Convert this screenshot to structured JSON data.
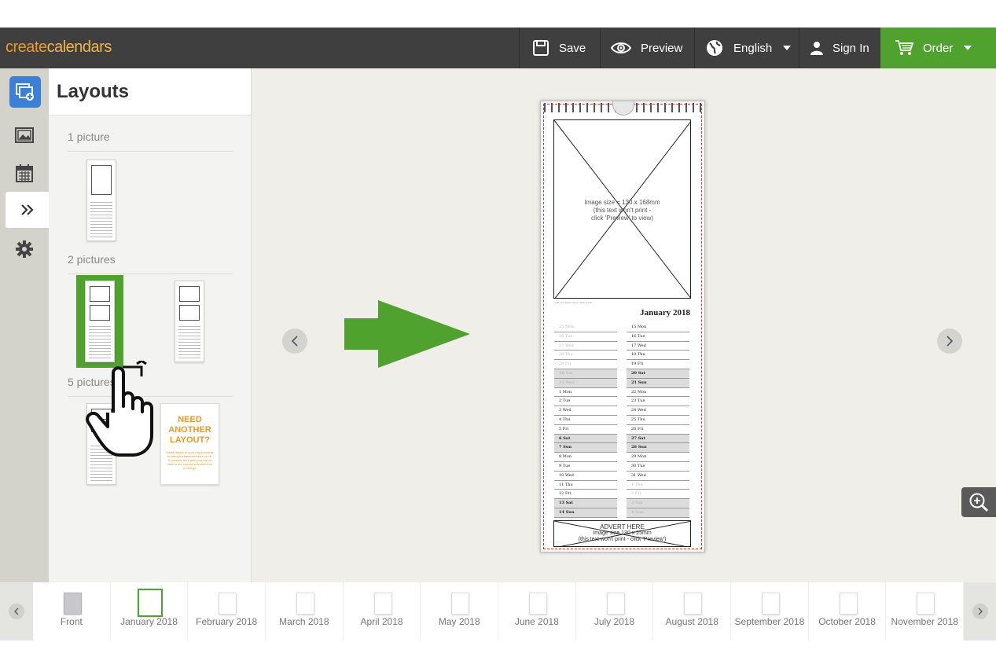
{
  "header": {
    "logo_part1": "create",
    "logo_part2": "calendars",
    "save": "Save",
    "preview": "Preview",
    "language": "English",
    "sign_in": "Sign In",
    "order": "Order",
    "order_color": "#4fa22e"
  },
  "rail": {
    "icons": [
      "add-photos-icon",
      "photos-icon",
      "calendar-icon",
      "layouts-icon",
      "settings-icon"
    ]
  },
  "panel": {
    "title": "Layouts",
    "sections": [
      "1 picture",
      "2 pictures",
      "5 pictures"
    ],
    "need_title": "NEED ANOTHER LAYOUT?",
    "need_body": "Email details of your requirements to sales@createcalendars.co.uk. If possible we'll add your layout idea to our current selection free of charge."
  },
  "calendar": {
    "image_text_1": "Image size = 130 x 168mm",
    "image_text_2": "(this text won't print -",
    "image_text_3": "click 'Preview' to view)",
    "caption": "Add your caption here - click to edit",
    "month_title": "January 2018",
    "left_days": [
      {
        "t": "25 Mon",
        "s": "fade"
      },
      {
        "t": "26 Tue",
        "s": "fade"
      },
      {
        "t": "27 Wed",
        "s": "fade"
      },
      {
        "t": "28 Thu",
        "s": "fade"
      },
      {
        "t": "29 Fri",
        "s": "fade"
      },
      {
        "t": "30 Sat",
        "s": "fade we"
      },
      {
        "t": "31 Sun",
        "s": "fade we"
      },
      {
        "t": "1 Mon",
        "s": ""
      },
      {
        "t": "2 Tue",
        "s": ""
      },
      {
        "t": "3 Wed",
        "s": ""
      },
      {
        "t": "4 Thu",
        "s": ""
      },
      {
        "t": "5 Fri",
        "s": ""
      },
      {
        "t": "6 Sat",
        "s": "we"
      },
      {
        "t": "7 Sun",
        "s": "we"
      },
      {
        "t": "8 Mon",
        "s": ""
      },
      {
        "t": "9 Tue",
        "s": ""
      },
      {
        "t": "10 Wed",
        "s": ""
      },
      {
        "t": "11 Thu",
        "s": ""
      },
      {
        "t": "12 Fri",
        "s": ""
      },
      {
        "t": "13 Sat",
        "s": "we"
      },
      {
        "t": "14 Sun",
        "s": "we"
      }
    ],
    "right_days": [
      {
        "t": "15 Mon",
        "s": ""
      },
      {
        "t": "16 Tue",
        "s": ""
      },
      {
        "t": "17 Wed",
        "s": ""
      },
      {
        "t": "18 Thu",
        "s": ""
      },
      {
        "t": "19 Fri",
        "s": ""
      },
      {
        "t": "20 Sat",
        "s": "we"
      },
      {
        "t": "21 Sun",
        "s": "we"
      },
      {
        "t": "22 Mon",
        "s": ""
      },
      {
        "t": "23 Tue",
        "s": ""
      },
      {
        "t": "24 Wed",
        "s": ""
      },
      {
        "t": "25 Thu",
        "s": ""
      },
      {
        "t": "26 Fri",
        "s": ""
      },
      {
        "t": "27 Sat",
        "s": "we"
      },
      {
        "t": "28 Sun",
        "s": "we"
      },
      {
        "t": "29 Mon",
        "s": ""
      },
      {
        "t": "30 Tue",
        "s": ""
      },
      {
        "t": "31 Wed",
        "s": ""
      },
      {
        "t": "1 Thu",
        "s": "fade"
      },
      {
        "t": "2 Fri",
        "s": "fade"
      },
      {
        "t": "3 Sat",
        "s": "fade we"
      },
      {
        "t": "4 Sun",
        "s": "fade we"
      }
    ],
    "advert_title": "ADVERT HERE",
    "advert_text_1": "Image size 130 x 25mm",
    "advert_text_2": "(this text won't print - click 'Preview')"
  },
  "months": [
    {
      "label": "Front",
      "front": true,
      "active": false
    },
    {
      "label": "January 2018",
      "front": false,
      "active": true
    },
    {
      "label": "February 2018",
      "front": false,
      "active": false
    },
    {
      "label": "March 2018",
      "front": false,
      "active": false
    },
    {
      "label": "April 2018",
      "front": false,
      "active": false
    },
    {
      "label": "May 2018",
      "front": false,
      "active": false
    },
    {
      "label": "June 2018",
      "front": false,
      "active": false
    },
    {
      "label": "July 2018",
      "front": false,
      "active": false
    },
    {
      "label": "August 2018",
      "front": false,
      "active": false
    },
    {
      "label": "September 2018",
      "front": false,
      "active": false
    },
    {
      "label": "October 2018",
      "front": false,
      "active": false
    },
    {
      "label": "November 2018",
      "front": false,
      "active": false
    }
  ]
}
